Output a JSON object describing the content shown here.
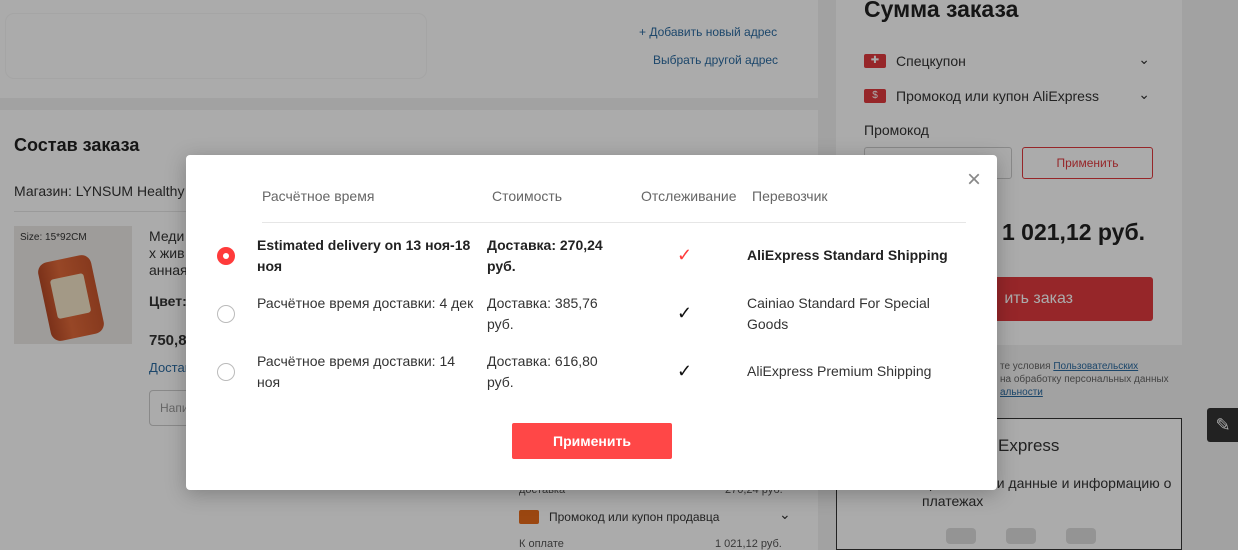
{
  "address": {
    "add_new": "+ Добавить новый адрес",
    "choose_other": "Выбрать другой адрес"
  },
  "order": {
    "title": "Состав заказа",
    "store": "Магазин: LYNSUM Healthy",
    "product_size": "Size: 15*92CM",
    "product_title_lines": [
      "Меди",
      "х жив",
      "анная"
    ],
    "color_label": "Цвет:",
    "price_partial": "750,8",
    "delivery_partial": "Достав",
    "note_placeholder": "Напи",
    "bottom_delivery_label": "доставка",
    "bottom_delivery_value": "270,24 руб.",
    "seller_coupon": "Промокод или купон продавца",
    "to_pay_label": "К оплате",
    "to_pay_value": "1 021,12 руб."
  },
  "summary": {
    "title": "Сумма заказа",
    "coupon_special": "Спецкупон",
    "coupon_ali": "Промокод или купон AliExpress",
    "promo_label": "Промокод",
    "promo_apply": "Применить",
    "total": "1 021,12 руб.",
    "place_order_partial": "ить заказ",
    "legal_line1": "те условия",
    "legal_link1": "Пользовательских",
    "legal_line2": "на обработку персональных данных",
    "legal_link2": "альности",
    "trust_logo": "Express",
    "trust_text": "хранит ваши данные и информацию о платежах"
  },
  "modal": {
    "headers": {
      "time": "Расчётное время",
      "cost": "Стоимость",
      "tracking": "Отслеживание",
      "carrier": "Перевозчик"
    },
    "options": [
      {
        "time": "Estimated delivery on 13 ноя-18 ноя",
        "cost": "Доставка: 270,24 руб.",
        "tracking": "✓",
        "carrier": "AliExpress Standard Shipping",
        "selected": true
      },
      {
        "time": "Расчётное время доставки: 4 дек",
        "cost": "Доставка: 385,76 руб.",
        "tracking": "✓",
        "carrier": "Cainiao Standard For Special Goods",
        "selected": false
      },
      {
        "time": "Расчётное время доставки: 14 ноя",
        "cost": "Доставка: 616,80 руб.",
        "tracking": "✓",
        "carrier": "AliExpress Premium Shipping",
        "selected": false
      }
    ],
    "apply": "Применить",
    "close": "×"
  },
  "colors": {
    "accent": "#ff4747",
    "link": "#2b6aa0",
    "overlay": "rgba(0,0,0,0.33)"
  }
}
